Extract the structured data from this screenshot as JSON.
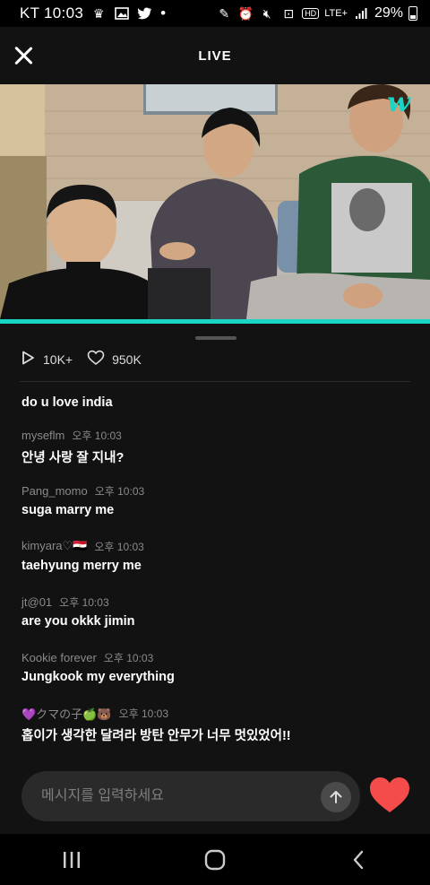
{
  "status_bar": {
    "carrier_time": "KT 10:03",
    "dot": "•",
    "network": "LTE+",
    "battery": "29%"
  },
  "header": {
    "title": "LIVE"
  },
  "video": {
    "watermark": "w"
  },
  "stats": {
    "plays": "10K+",
    "likes": "950K"
  },
  "chat": {
    "partial_top": "♥ ...",
    "messages": [
      {
        "user": "",
        "time": "",
        "text": "do u love india"
      },
      {
        "user": "myseflm",
        "time": "오후 10:03",
        "text": "안녕 사랑 잘 지내?"
      },
      {
        "user": "Pang_momo",
        "time": "오후 10:03",
        "text": "suga marry me"
      },
      {
        "user": "kimyara♡🇪🇬",
        "time": "오후 10:03",
        "text": "taehyung merry me"
      },
      {
        "user": "jt@01",
        "time": "오후 10:03",
        "text": "are you okkk jimin"
      },
      {
        "user": "Kookie forever",
        "time": "오후 10:03",
        "text": "Jungkook my everything"
      },
      {
        "user": "💜クマの子🍏🐻",
        "time": "오후 10:03",
        "text": "홉이가 생각한 달려라 방탄 안무가 너무 멋있었어!!"
      }
    ]
  },
  "input": {
    "placeholder": "메시지를 입력하세요"
  },
  "colors": {
    "accent": "#1ad4c4",
    "heart": "#f44b4b",
    "background": "#121212"
  }
}
